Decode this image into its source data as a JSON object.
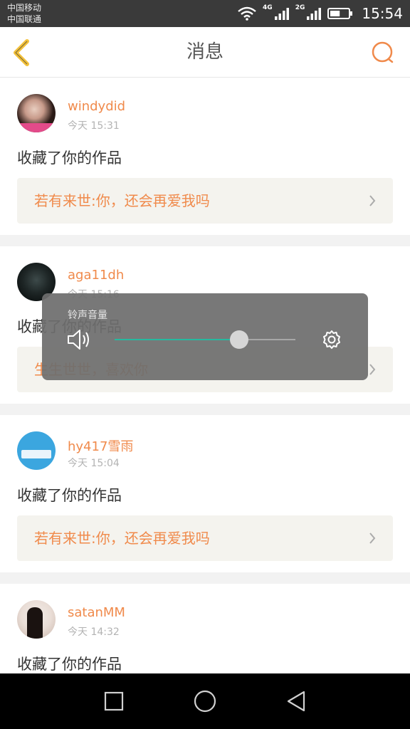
{
  "status_bar": {
    "carrier_1": "中国移动",
    "carrier_2": "中国联通",
    "net_1": "4G",
    "net_2": "2G",
    "time": "15:54",
    "battery_level": 0.55
  },
  "header": {
    "title": "消息",
    "back_icon": "chevron-left-icon",
    "search_icon": "search-icon"
  },
  "messages": [
    {
      "username": "windydid",
      "time": "今天 15:31",
      "action": "收藏了你的作品",
      "work_title": "若有来世:你，还会再爱我吗"
    },
    {
      "username": "aga11dh",
      "time": "今天 15:16",
      "action": "收藏了你的作品",
      "work_title": "生生世世，喜欢你"
    },
    {
      "username": "hy417雪雨",
      "time": "今天 15:04",
      "action": "收藏了你的作品",
      "work_title": "若有来世:你，还会再爱我吗"
    },
    {
      "username": "satanMM",
      "time": "今天 14:32",
      "action": "收藏了你的作品"
    }
  ],
  "volume_overlay": {
    "label": "铃声音量",
    "level": 0.69,
    "speaker_icon": "speaker-icon",
    "settings_icon": "gear-icon"
  },
  "nav_bar": {
    "recents_icon": "square-icon",
    "home_icon": "circle-icon",
    "back_icon": "triangle-back-icon"
  },
  "colors": {
    "accent": "#f08a4b",
    "slider": "#26b9a0",
    "back_arrow": "#f3c13a"
  }
}
